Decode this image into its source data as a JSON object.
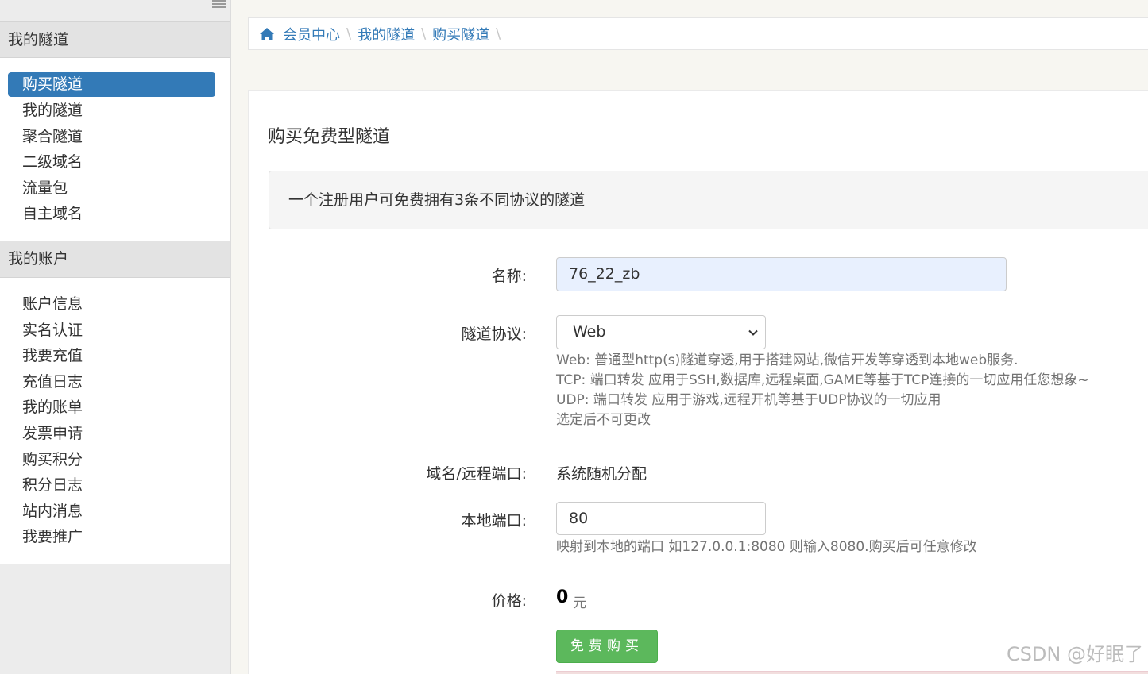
{
  "sidebar": {
    "section1": {
      "title": "我的隧道",
      "items": [
        "购买隧道",
        "我的隧道",
        "聚合隧道",
        "二级域名",
        "流量包",
        "自主域名"
      ],
      "active_index": 0
    },
    "section2": {
      "title": "我的账户",
      "items": [
        "账户信息",
        "实名认证",
        "我要充值",
        "充值日志",
        "我的账单",
        "发票申请",
        "购买积分",
        "积分日志",
        "站内消息",
        "我要推广"
      ]
    }
  },
  "breadcrumb": {
    "home_icon": "home-icon",
    "items": [
      "会员中心",
      "我的隧道",
      "购买隧道"
    ]
  },
  "page": {
    "title": "购买免费型隧道",
    "notice": "一个注册用户可免费拥有3条不同协议的隧道"
  },
  "form": {
    "name": {
      "label": "名称:",
      "value": "76_22_zb"
    },
    "protocol": {
      "label": "隧道协议:",
      "value": "Web",
      "help": [
        "Web: 普通型http(s)隧道穿透,用于搭建网站,微信开发等穿透到本地web服务.",
        "TCP: 端口转发 应用于SSH,数据库,远程桌面,GAME等基于TCP连接的一切应用任您想象~",
        "UDP: 端口转发 应用于游戏,远程开机等基于UDP协议的一切应用",
        "选定后不可更改"
      ]
    },
    "domain": {
      "label": "域名/远程端口:",
      "value": "系统随机分配"
    },
    "local_port": {
      "label": "本地端口:",
      "value": "80",
      "help": "映射到本地的端口 如127.0.0.1:8080 则输入8080.购买后可任意修改"
    },
    "price": {
      "label": "价格:",
      "value": "0",
      "unit": "元"
    },
    "submit_label": "免费购买"
  },
  "watermark": "CSDN @好眠了",
  "colors": {
    "primary": "#337ab7",
    "success": "#5cb85c",
    "sidebar_bg": "#ececec"
  }
}
